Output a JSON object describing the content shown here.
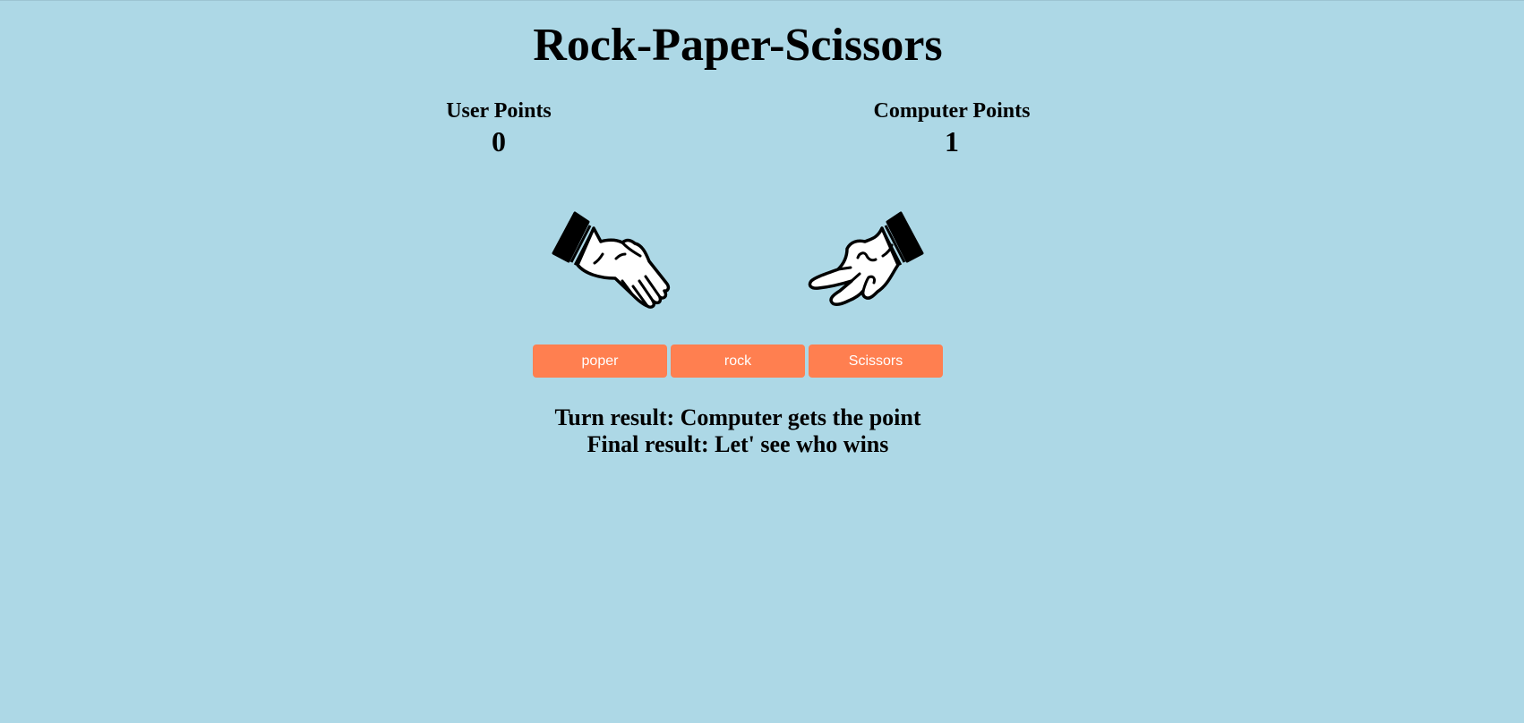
{
  "page": {
    "title": "Rock-Paper-Scissors",
    "background_color": "#add8e6"
  },
  "scores": {
    "user_label": "User Points",
    "user_value": "0",
    "computer_label": "Computer Points",
    "computer_value": "1"
  },
  "hands": {
    "user_choice": "paper",
    "computer_choice": "scissors"
  },
  "buttons": {
    "paper_label": "poper",
    "rock_label": "rock",
    "scissors_label": "Scissors",
    "color": "#ff7f50"
  },
  "results": {
    "turn_text": "Turn result: Computer gets the point",
    "final_text": "Final result: Let' see who wins"
  }
}
